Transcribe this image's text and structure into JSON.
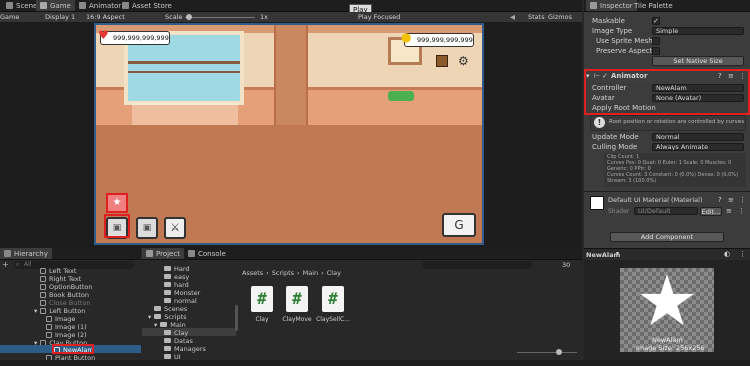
{
  "game_view": {
    "tabs": [
      {
        "label": "Scene"
      },
      {
        "label": "Game"
      },
      {
        "label": "Animator"
      },
      {
        "label": "Asset Store"
      }
    ],
    "toolbar": {
      "display_mode": "Game",
      "display": "Display 1",
      "aspect": "16:9 Aspect",
      "scale_label": "Scale",
      "scale_value": "1x",
      "play_focused": "Play Focused",
      "stats": "Stats",
      "gizmos": "Gizmos",
      "play_tooltip": "Play"
    },
    "hud": {
      "hearts_value": "999,999,999,999",
      "coins_value": "999,999,999,999"
    }
  },
  "inspector": {
    "tabs": [
      {
        "label": "Inspector"
      },
      {
        "label": "Tile Palette"
      }
    ],
    "image_fields": {
      "maskable_label": "Maskable",
      "image_type_label": "Image Type",
      "image_type_value": "Simple",
      "use_sprite_mesh_label": "Use Sprite Mesh",
      "preserve_aspect_label": "Preserve Aspect",
      "set_native_size": "Set Native Size"
    },
    "animator": {
      "title": "Animator",
      "controller_label": "Controller",
      "controller_value": "NewAlam",
      "avatar_label": "Avatar",
      "avatar_value": "None (Avatar)",
      "apply_root_motion_label": "Apply Root Motion",
      "root_info": "Root position or rotation are controlled by curves",
      "update_mode_label": "Update Mode",
      "update_mode_value": "Normal",
      "culling_mode_label": "Culling Mode",
      "culling_mode_value": "Always Animate",
      "stats_lines": [
        "Clip Count: 1",
        "Curves Pos: 0 Quat: 0 Euler: 1 Scale: 0 Muscles: 0",
        "Generic: 0 PPtr: 0",
        "Curves Count: 3 Constant: 0 (0.0%) Dense: 0 (0.0%)",
        "Stream: 3 (100.0%)"
      ]
    },
    "material": {
      "title": "Default UI Material (Material)",
      "shader_label": "Shader",
      "shader_value": "UI/Default",
      "edit_label": "Edit..."
    },
    "add_component": "Add Component",
    "preview": {
      "title": "NewAlam",
      "caption_name": "NewAlam",
      "caption_size": "Image Size: 256x256"
    }
  },
  "hierarchy": {
    "tab": "Hierarchy",
    "search_placeholder": "All",
    "items": [
      {
        "label": "Left Text"
      },
      {
        "label": "Right Text"
      },
      {
        "label": "OptionButton"
      },
      {
        "label": "Book Button"
      },
      {
        "label": "Close Button"
      },
      {
        "label": "Left Button"
      },
      {
        "label": "Image"
      },
      {
        "label": "Image (1)"
      },
      {
        "label": "Image (2)"
      },
      {
        "label": "Clay Button"
      },
      {
        "label": "NewAlam"
      },
      {
        "label": "Plant Button"
      }
    ]
  },
  "project": {
    "tabs": [
      {
        "label": "Project"
      },
      {
        "label": "Console"
      }
    ],
    "hidden_count": "30",
    "breadcrumb": [
      "Assets",
      "Scripts",
      "Main",
      "Clay"
    ],
    "tree": [
      {
        "label": "Hard"
      },
      {
        "label": "easy"
      },
      {
        "label": "hard"
      },
      {
        "label": "Monster"
      },
      {
        "label": "normal"
      },
      {
        "label": "Scenes"
      },
      {
        "label": "Scripts"
      },
      {
        "label": "Main"
      },
      {
        "label": "Clay"
      },
      {
        "label": "Datas"
      },
      {
        "label": "Managers"
      },
      {
        "label": "UI"
      }
    ],
    "assets": [
      {
        "label": "Clay"
      },
      {
        "label": "ClayMove"
      },
      {
        "label": "ClaySellC..."
      }
    ]
  },
  "colors": {
    "highlight": "#e02020",
    "accent": "#2c5d87"
  }
}
